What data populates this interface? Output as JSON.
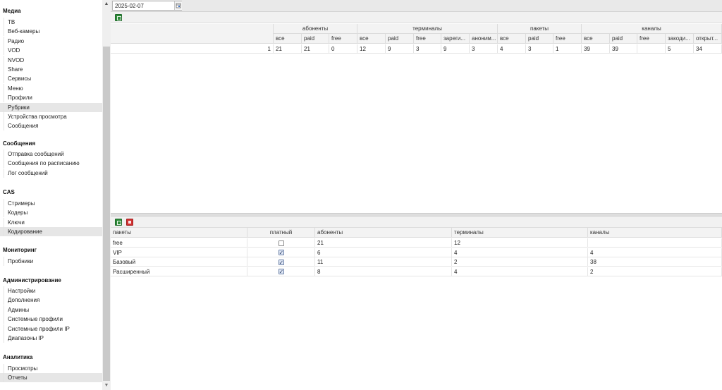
{
  "sidebar": {
    "sections": [
      {
        "title": "Медиа",
        "items": [
          {
            "label": "ТВ"
          },
          {
            "label": "Веб-камеры"
          },
          {
            "label": "Радио"
          },
          {
            "label": "VOD"
          },
          {
            "label": "NVOD"
          },
          {
            "label": "Share"
          },
          {
            "label": "Сервисы"
          },
          {
            "label": "Меню"
          },
          {
            "label": "Профили"
          },
          {
            "label": "Рубрики",
            "highlighted": true
          },
          {
            "label": "Устройства просмотра"
          },
          {
            "label": "Сообщения"
          }
        ]
      },
      {
        "title": "Сообщения",
        "items": [
          {
            "label": "Отправка сообщений"
          },
          {
            "label": "Сообщения по расписанию"
          },
          {
            "label": "Лог сообщений"
          }
        ]
      },
      {
        "title": "CAS",
        "items": [
          {
            "label": "Стримеры"
          },
          {
            "label": "Кодеры"
          },
          {
            "label": "Ключи"
          },
          {
            "label": "Кодирование",
            "highlighted": true
          }
        ]
      },
      {
        "title": "Мониторинг",
        "items": [
          {
            "label": "Пробники"
          }
        ]
      },
      {
        "title": "Администрирование",
        "items": [
          {
            "label": "Настройки"
          },
          {
            "label": "Дополнения"
          },
          {
            "label": "Админы"
          },
          {
            "label": "Системные профили"
          },
          {
            "label": "Системные профили IP"
          },
          {
            "label": "Диапазоны IP"
          }
        ]
      },
      {
        "title": "Аналитика",
        "items": [
          {
            "label": "Просмотры"
          },
          {
            "label": "Отчеты",
            "selected": true
          }
        ]
      }
    ],
    "scroll_up_icon": "triangle-up-icon",
    "scroll_down_icon": "triangle-down-icon"
  },
  "date_picker": {
    "value": "2025-02-07",
    "icon": "calendar-icon"
  },
  "summary": {
    "toolbar_icons": [
      "export-excel-icon"
    ],
    "groups": [
      "абоненты",
      "терминалы",
      "пакеты",
      "каналы"
    ],
    "columns": [
      "все",
      "paid",
      "free",
      "все",
      "paid",
      "free",
      "зареги...",
      "аноним...",
      "все",
      "paid",
      "free",
      "все",
      "paid",
      "free",
      "закоди...",
      "открыт..."
    ],
    "rows": [
      {
        "num": "1",
        "cells": [
          "21",
          "21",
          "0",
          "12",
          "9",
          "3",
          "9",
          "3",
          "4",
          "3",
          "1",
          "39",
          "39",
          "",
          "5",
          "34"
        ]
      }
    ]
  },
  "packages": {
    "toolbar_icons": [
      "export-excel-icon",
      "export-pdf-icon"
    ],
    "columns": [
      "пакеты",
      "платный",
      "абоненты",
      "терминалы",
      "каналы"
    ],
    "rows": [
      {
        "name": "free",
        "paid": false,
        "subscribers": "21",
        "terminals": "12",
        "channels": ""
      },
      {
        "name": "VIP",
        "paid": true,
        "subscribers": "6",
        "terminals": "4",
        "channels": "4"
      },
      {
        "name": "Базовый",
        "paid": true,
        "subscribers": "11",
        "terminals": "2",
        "channels": "38"
      },
      {
        "name": "Расширенный",
        "paid": true,
        "subscribers": "8",
        "terminals": "4",
        "channels": "2"
      }
    ]
  },
  "colors": {
    "selected_bg": "#e6e6e6",
    "excel_green": "#2e8b3a",
    "pdf_red": "#d23333"
  }
}
